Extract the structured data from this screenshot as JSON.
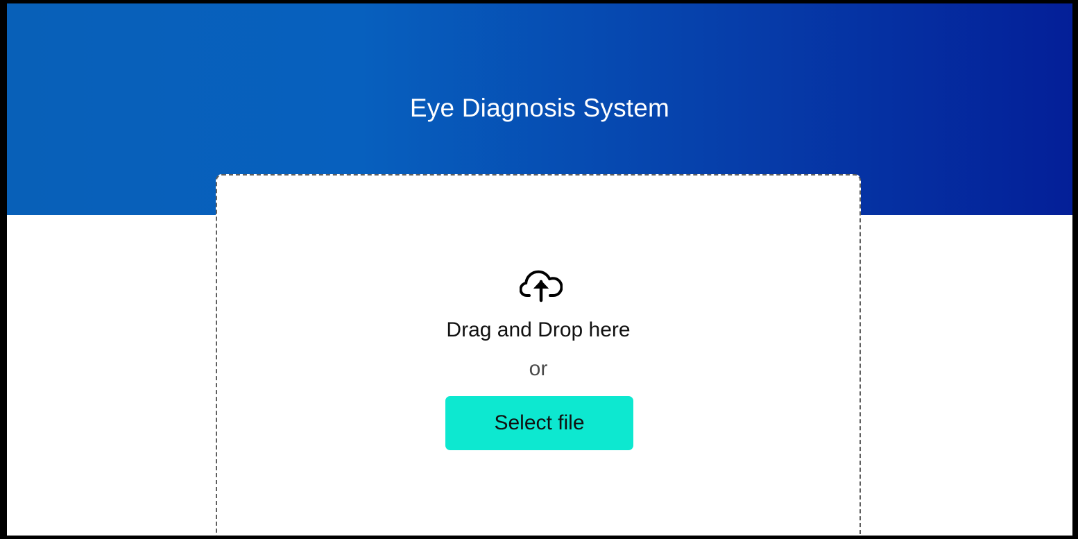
{
  "header": {
    "title": "Eye Diagnosis System"
  },
  "upload": {
    "icon": "cloud-upload-icon",
    "drag_text": "Drag and Drop here",
    "or_text": "or",
    "select_label": "Select file"
  },
  "colors": {
    "header_gradient_start": "#0860b8",
    "header_gradient_end": "#041f98",
    "button_background": "#0de8d0",
    "dropzone_border": "#5f5f5f"
  }
}
